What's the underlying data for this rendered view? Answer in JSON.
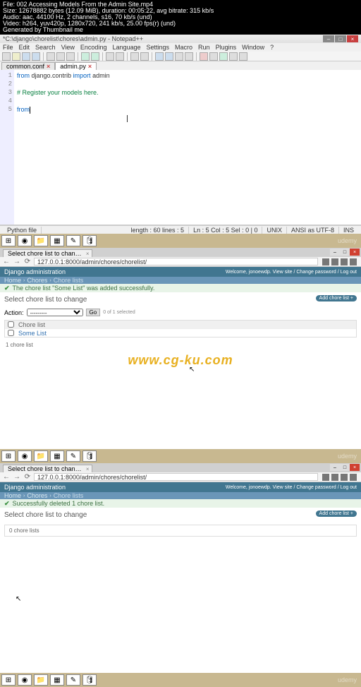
{
  "console": {
    "l1": "File: 002 Accessing Models From the Admin Site.mp4",
    "l2": "Size: 12678882 bytes (12.09 MiB), duration: 00:05:22, avg bitrate: 315 kb/s",
    "l3": "Audio: aac, 44100 Hz, 2 channels, s16, 70 kb/s (und)",
    "l4": "Video: h264, yuv420p, 1280x720, 241 kb/s, 25.00 fps(r) (und)",
    "l5": "Generated by Thumbnail me"
  },
  "npp": {
    "title": "*C:\\django\\chorelist\\chores\\admin.py - Notepad++",
    "menu": [
      "File",
      "Edit",
      "Search",
      "View",
      "Encoding",
      "Language",
      "Settings",
      "Macro",
      "Run",
      "Plugins",
      "Window",
      "?"
    ],
    "tab_inactive": "common.conf",
    "tab_active": "admin.py",
    "code": {
      "l1a": "from",
      "l1b": " django.contrib ",
      "l1c": "import",
      "l1d": " admin",
      "l3": "# Register your models here.",
      "l5": "from"
    },
    "status": {
      "length": "length : 60   lines : 5",
      "pos": "Ln : 5   Col : 5   Sel : 0 | 0",
      "eol": "UNIX",
      "enc": "ANSI as UTF-8",
      "ins": "INS"
    }
  },
  "browser": {
    "tab": "Select chore list to chan…",
    "url": "127.0.0.1:8000/admin/chores/chorelist/"
  },
  "django1": {
    "title": "Django administration",
    "welcome": "Welcome, jonoewdp. View site / Change password / Log out",
    "crumbs": {
      "home": "Home",
      "app": "Chores",
      "page": "Chore lists"
    },
    "msg": "The chore list \"Some List\" was added successfully.",
    "section": "Select chore list to change",
    "add": "Add chore list +",
    "action_label": "Action:",
    "action_opt": "---------",
    "go": "Go",
    "sel_count": "0 of 1 selected",
    "th": "Chore list",
    "row": "Some List",
    "count": "1 chore list"
  },
  "django2": {
    "title": "Django administration",
    "welcome": "Welcome, jonoewdp. View site / Change password / Log out",
    "crumbs": {
      "home": "Home",
      "app": "Chores",
      "page": "Chore lists"
    },
    "msg": "Successfully deleted 1 chore list.",
    "section": "Select chore list to change",
    "add": "Add chore list +",
    "count": "0 chore lists"
  },
  "watermark": "www.cg-ku.com",
  "udemy": "udemy"
}
